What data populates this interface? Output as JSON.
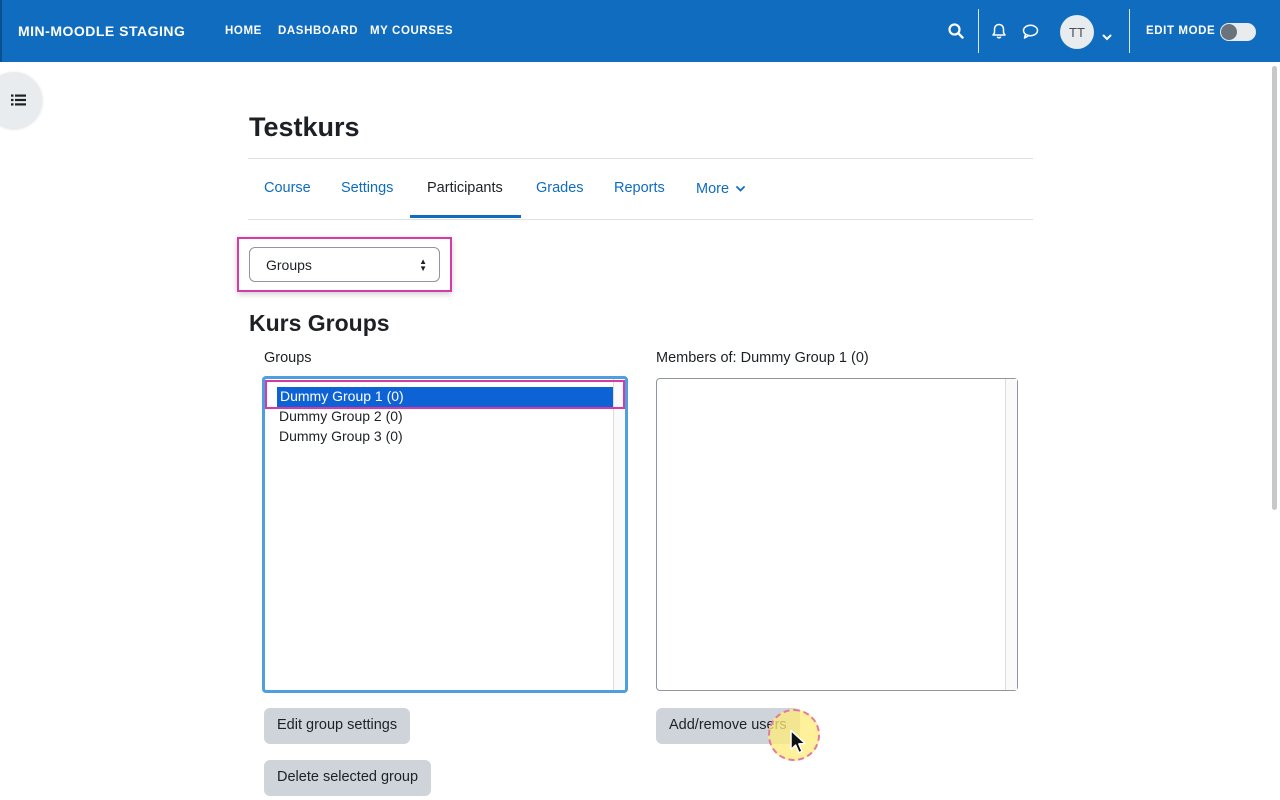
{
  "header": {
    "brand": "MIN-MOODLE STAGING",
    "nav": [
      "HOME",
      "DASHBOARD",
      "MY COURSES"
    ],
    "avatar_initials": "TT",
    "edit_mode_label": "EDIT MODE",
    "edit_mode_on": false,
    "accent_color": "#0f6cbf"
  },
  "course": {
    "title": "Testkurs",
    "tabs": [
      "Course",
      "Settings",
      "Participants",
      "Grades",
      "Reports",
      "More"
    ],
    "active_tab": "Participants"
  },
  "page_select": {
    "value": "Groups"
  },
  "section_title": "Kurs Groups",
  "groups_panel": {
    "label": "Groups",
    "items": [
      "Dummy Group 1 (0)",
      "Dummy Group 2 (0)",
      "Dummy Group 3 (0)"
    ],
    "selected_index": 0
  },
  "members_panel": {
    "label": "Members of: Dummy Group 1 (0)"
  },
  "buttons": {
    "edit_group_settings": "Edit group settings",
    "delete_selected_group": "Delete selected group",
    "add_remove_users": "Add/remove users"
  },
  "icons": {
    "search": "search-icon",
    "notifications": "bell-icon",
    "messages": "chat-icon",
    "drawer": "list-icon"
  }
}
